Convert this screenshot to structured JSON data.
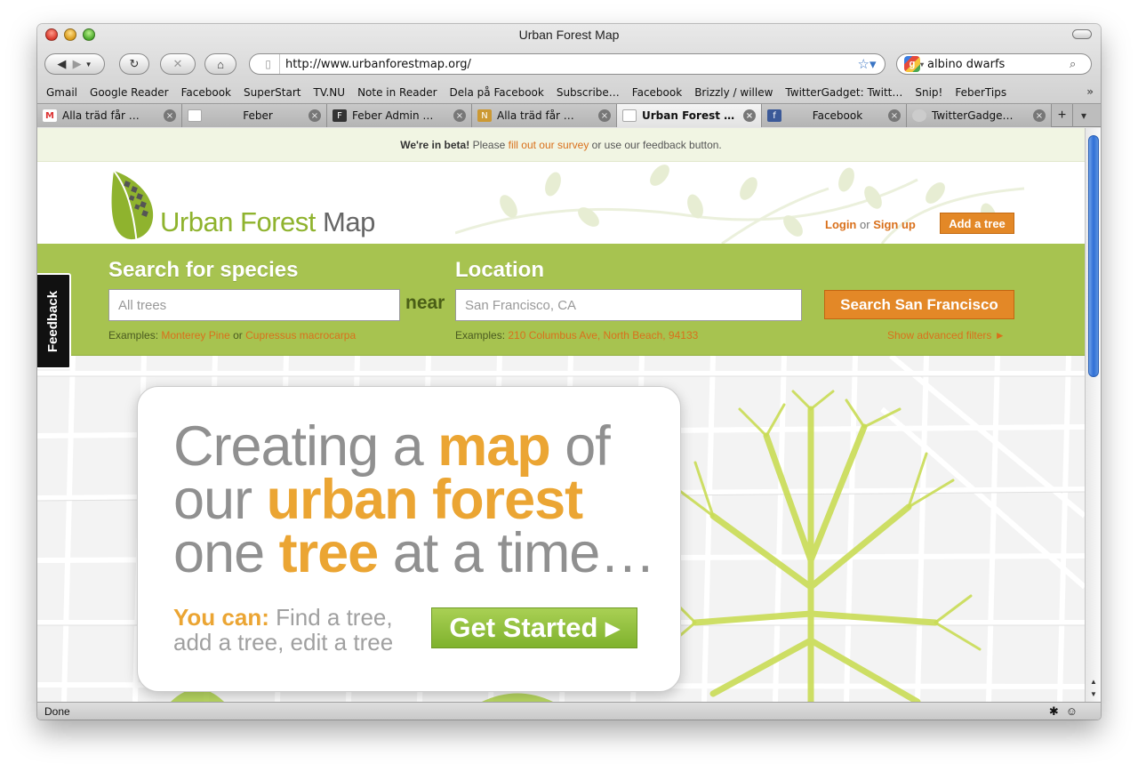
{
  "window": {
    "title": "Urban Forest Map"
  },
  "toolbar": {
    "url": "http://www.urbanforestmap.org/",
    "search_query": "albino dwarfs"
  },
  "bookmarks": [
    "Gmail",
    "Google Reader",
    "Facebook",
    "SuperStart",
    "TV.NU",
    "Note in Reader",
    "Dela på Facebook",
    "Subscribe…",
    "Facebook",
    "Brizzly / willew",
    "TwitterGadget: Twitt…",
    "Snip!",
    "FeberTips"
  ],
  "tabs": [
    {
      "label": "Alla träd får …",
      "active": false
    },
    {
      "label": "Feber",
      "active": false
    },
    {
      "label": "Feber Admin …",
      "active": false
    },
    {
      "label": "Alla träd får …",
      "active": false
    },
    {
      "label": "Urban Forest …",
      "active": true
    },
    {
      "label": "Facebook",
      "active": false
    },
    {
      "label": "TwitterGadge…",
      "active": false
    }
  ],
  "page": {
    "beta": {
      "strong": "We're in beta!",
      "pre": "Please",
      "link": "fill out our survey",
      "post": "or use our feedback button."
    },
    "logo": {
      "part1": "Urban Forest",
      "part2": "Map"
    },
    "login": {
      "login": "Login",
      "or": "or",
      "signup": "Sign up"
    },
    "add_tree": "Add a tree",
    "search": {
      "species_heading": "Search for species",
      "species_placeholder": "All trees",
      "near": "near",
      "location_heading": "Location",
      "location_placeholder": "San Francisco, CA",
      "button": "Search San Francisco",
      "species_examples_prefix": "Examples:",
      "species_example_1": "Monterey Pine",
      "or": "or",
      "species_example_2": "Cupressus macrocarpa",
      "location_examples_prefix": "Examples:",
      "location_examples": "210 Columbus Ave, North Beach, 94133",
      "advanced": "Show advanced filters ►"
    },
    "hero": {
      "l1a": "Creating a",
      "l1b": "map",
      "l1c": "of",
      "l2a": "our",
      "l2b": "urban forest",
      "l3a": "one",
      "l3b": "tree",
      "l3c": "at a time…",
      "you_can": "You can:",
      "you_can_1": "Find a tree,",
      "you_can_2": "add a tree, edit a tree",
      "cta": "Get Started ▸"
    },
    "feedback": "Feedback"
  },
  "status": {
    "text": "Done"
  },
  "colors": {
    "accent_green": "#a7c350",
    "accent_orange": "#e38827",
    "hero_orange": "#eba533"
  }
}
